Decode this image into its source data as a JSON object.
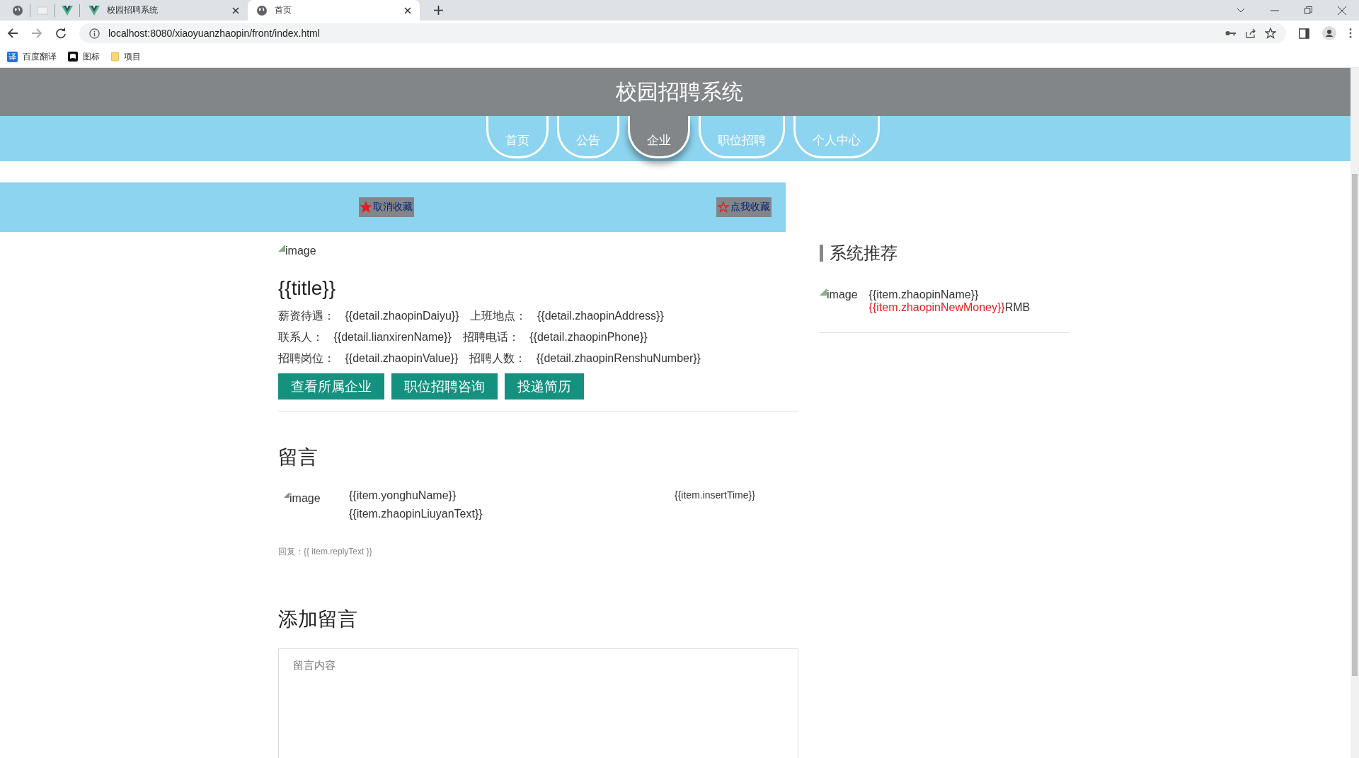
{
  "browser": {
    "tabs": [
      {
        "kind": "globe",
        "selected": false
      },
      {
        "kind": "blank",
        "selected": false
      },
      {
        "kind": "vue",
        "selected": false
      },
      {
        "kind": "vue",
        "title": "校园招聘系统",
        "selected": false
      },
      {
        "kind": "globe",
        "title": "首页",
        "selected": true
      }
    ],
    "address": "localhost:8080/xiaoyuanzhaopin/front/index.html",
    "bookmarks": [
      {
        "kind": "translate",
        "label": "百度翻译",
        "glyph": "译"
      },
      {
        "kind": "flag",
        "label": "图标"
      },
      {
        "kind": "folder",
        "label": "项目"
      }
    ]
  },
  "site_title": "校园招聘系统",
  "nav": [
    {
      "label": "首页",
      "selected": false
    },
    {
      "label": "公告",
      "selected": false
    },
    {
      "label": "企业",
      "selected": true
    },
    {
      "label": "职位招聘",
      "selected": false
    },
    {
      "label": "个人中心",
      "selected": false
    }
  ],
  "favorites": [
    {
      "label": "取消收藏",
      "filled": true
    },
    {
      "label": "点我收藏",
      "filled": false
    }
  ],
  "detail": {
    "image_alt": "image",
    "title": "{{title}}",
    "rows": [
      [
        {
          "label": "薪资待遇：",
          "value": "{{detail.zhaopinDaiyu}}"
        },
        {
          "label": "上班地点：",
          "value": "{{detail.zhaopinAddress}}"
        }
      ],
      [
        {
          "label": "联系人：",
          "value": "{{detail.lianxirenName}}"
        },
        {
          "label": "招聘电话：",
          "value": "{{detail.zhaopinPhone}}"
        }
      ],
      [
        {
          "label": "招聘岗位：",
          "value": "{{detail.zhaopinValue}}"
        },
        {
          "label": "招聘人数：",
          "value": "{{detail.zhaopinRenshuNumber}}"
        }
      ]
    ],
    "buttons": [
      "查看所属企业",
      "职位招聘咨询",
      "投递简历"
    ]
  },
  "comments": {
    "heading": "留言",
    "items": [
      {
        "avatar_alt": "image",
        "name": "{{item.yonghuName}}",
        "text": "{{item.zhaopinLiuyanText}}",
        "time": "{{item.insertTime}}",
        "reply": "回复：{{ item.replyText }}"
      }
    ]
  },
  "add_comment": {
    "heading": "添加留言",
    "placeholder": "留言内容"
  },
  "sidebar": {
    "heading": "系统推荐",
    "items": [
      {
        "image_alt": "image",
        "name": "{{item.zhaopinName}}",
        "money": "{{item.zhaopinNewMoney}}",
        "unit": "RMB"
      }
    ]
  }
}
